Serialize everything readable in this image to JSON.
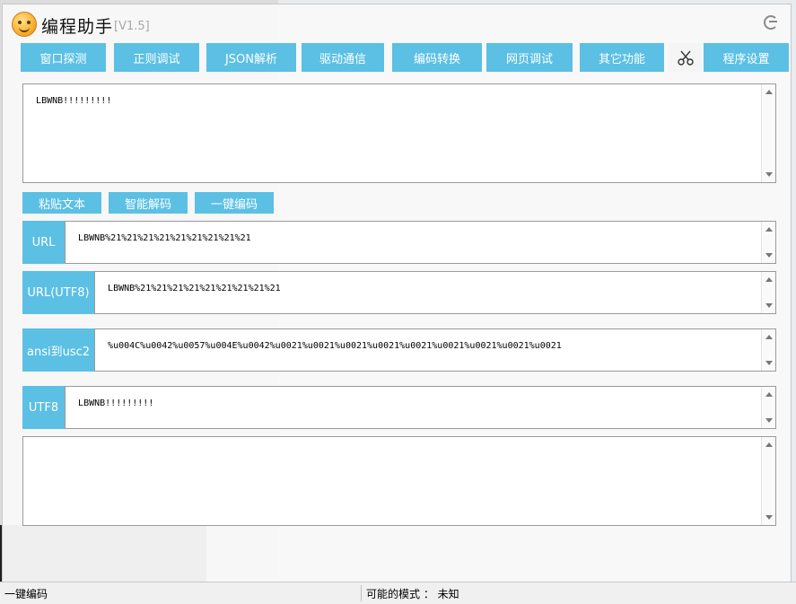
{
  "app": {
    "title": "编程助手",
    "version": "[V1.5]"
  },
  "tabs": [
    {
      "label": "窗口探测"
    },
    {
      "label": "正则调试"
    },
    {
      "label": "JSON解析"
    },
    {
      "label": "驱动通信"
    },
    {
      "label": "编码转换"
    },
    {
      "label": "网页调试"
    },
    {
      "label": "其它功能"
    },
    {
      "label": "程序设置"
    }
  ],
  "input": {
    "value": "LBWNB!!!!!!!!!"
  },
  "buttons": {
    "paste": "粘贴文本",
    "smart_decode": "智能解码",
    "one_click_encode": "一键编码"
  },
  "rows": {
    "url": {
      "label": "URL",
      "value": "LBWNB%21%21%21%21%21%21%21%21%21"
    },
    "url_utf8": {
      "label": "URL(UTF8)",
      "value": "LBWNB%21%21%21%21%21%21%21%21%21"
    },
    "ansi_usc2": {
      "label": "ansi到usc2",
      "value": "%u004C%u0042%u0057%u004E%u0042%u0021%u0021%u0021%u0021%u0021%u0021%u0021%u0021%u0021"
    },
    "utf8": {
      "label": "UTF8",
      "value": "LBWNB!!!!!!!!!"
    }
  },
  "output": {
    "value": ""
  },
  "status": {
    "left": "一键编码",
    "right": "可能的模式 ： 未知"
  },
  "colors": {
    "accent": "#5bc0e3"
  }
}
